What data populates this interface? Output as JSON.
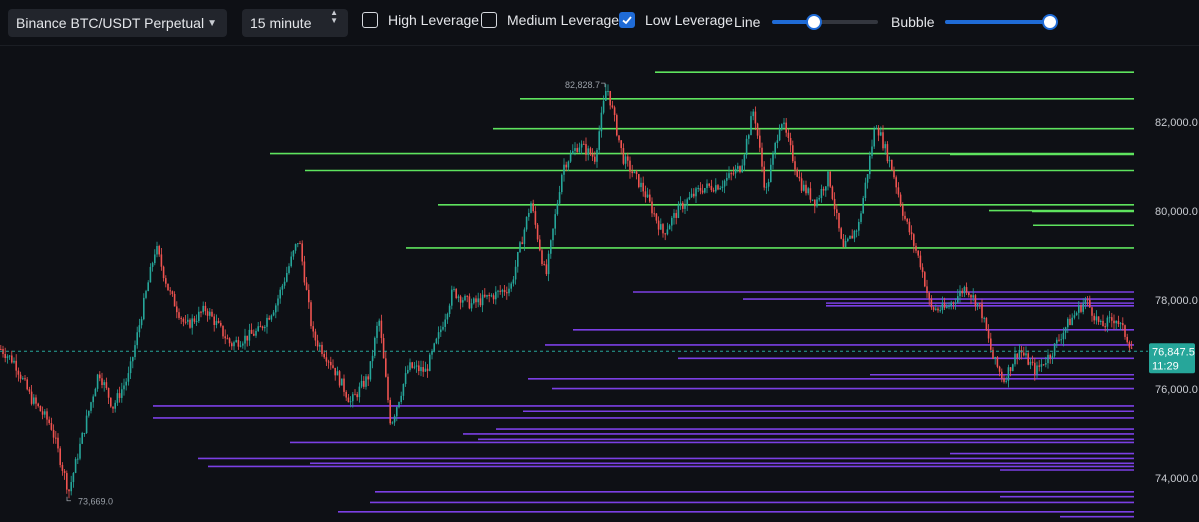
{
  "toolbar": {
    "symbol": "Binance BTC/USDT Perpetual",
    "interval": "15 minute",
    "high_leverage": {
      "label": "High Leverage",
      "checked": false
    },
    "medium_leverage": {
      "label": "Medium Leverage",
      "checked": false
    },
    "low_leverage": {
      "label": "Low Leverage",
      "checked": true
    },
    "line_label": "Line",
    "line_value": 0.38,
    "bubble_label": "Bubble",
    "bubble_value": 1.0
  },
  "colors": {
    "background": "#0e1015",
    "candle_up": "#26a69a",
    "candle_down": "#ef5350",
    "long_liquidation": "#5ee35e",
    "short_liquidation": "#7b3fe4",
    "price_tag": "#26a69a",
    "accent": "#1f6bd6"
  },
  "chart_data": {
    "type": "candlestick",
    "ylim": [
      73200,
      83200
    ],
    "yticks": [
      74000,
      76000,
      78000,
      80000,
      82000
    ],
    "ytick_labels": [
      "74,000.0",
      "76,000.0",
      "78,000.0",
      "80,000.0",
      "82,000.0"
    ],
    "current_price": 76847.5,
    "current_price_label": "76,847.5",
    "countdown": "11:29",
    "high": {
      "value": 82828.7,
      "label": "82,828.7"
    },
    "low": {
      "value": 73669.0,
      "label": "73,669.0"
    },
    "price_path": [
      [
        0,
        76900
      ],
      [
        14,
        76600
      ],
      [
        30,
        75800
      ],
      [
        50,
        75200
      ],
      [
        68,
        73700
      ],
      [
        80,
        74800
      ],
      [
        98,
        76400
      ],
      [
        112,
        75600
      ],
      [
        128,
        76300
      ],
      [
        140,
        77600
      ],
      [
        155,
        79200
      ],
      [
        168,
        78200
      ],
      [
        185,
        77400
      ],
      [
        205,
        77800
      ],
      [
        230,
        77000
      ],
      [
        258,
        77300
      ],
      [
        275,
        77900
      ],
      [
        298,
        79400
      ],
      [
        312,
        77200
      ],
      [
        330,
        76600
      ],
      [
        350,
        75700
      ],
      [
        368,
        76300
      ],
      [
        378,
        77600
      ],
      [
        390,
        75200
      ],
      [
        408,
        76500
      ],
      [
        425,
        76400
      ],
      [
        438,
        77200
      ],
      [
        452,
        78200
      ],
      [
        470,
        77900
      ],
      [
        492,
        78100
      ],
      [
        510,
        78300
      ],
      [
        530,
        80200
      ],
      [
        545,
        78500
      ],
      [
        562,
        81000
      ],
      [
        578,
        81500
      ],
      [
        594,
        81200
      ],
      [
        606,
        82830
      ],
      [
        622,
        81200
      ],
      [
        642,
        80500
      ],
      [
        662,
        79500
      ],
      [
        680,
        80100
      ],
      [
        700,
        80500
      ],
      [
        720,
        80600
      ],
      [
        740,
        81000
      ],
      [
        753,
        82300
      ],
      [
        765,
        80400
      ],
      [
        780,
        82100
      ],
      [
        800,
        80600
      ],
      [
        815,
        80200
      ],
      [
        828,
        80800
      ],
      [
        842,
        79100
      ],
      [
        858,
        79700
      ],
      [
        875,
        82000
      ],
      [
        892,
        80900
      ],
      [
        903,
        79900
      ],
      [
        920,
        78800
      ],
      [
        930,
        77800
      ],
      [
        945,
        77800
      ],
      [
        965,
        78300
      ],
      [
        980,
        77800
      ],
      [
        992,
        76700
      ],
      [
        1003,
        76200
      ],
      [
        1018,
        76900
      ],
      [
        1035,
        76400
      ],
      [
        1050,
        76800
      ],
      [
        1065,
        77400
      ],
      [
        1085,
        78000
      ],
      [
        1100,
        77400
      ],
      [
        1115,
        77600
      ],
      [
        1125,
        77200
      ],
      [
        1133,
        76850
      ]
    ],
    "long_liquidation_levels": [
      {
        "price": 83120,
        "x_start": 655
      },
      {
        "price": 82520,
        "x_start": 520
      },
      {
        "price": 81850,
        "x_start": 493
      },
      {
        "price": 81290,
        "x_start": 270
      },
      {
        "price": 81270,
        "x_start": 950
      },
      {
        "price": 80910,
        "x_start": 305
      },
      {
        "price": 80140,
        "x_start": 438
      },
      {
        "price": 80010,
        "x_start": 989
      },
      {
        "price": 79990,
        "x_start": 1032
      },
      {
        "price": 79680,
        "x_start": 1033
      },
      {
        "price": 79170,
        "x_start": 406
      }
    ],
    "short_liquidation_levels": [
      {
        "price": 78180,
        "x_start": 633
      },
      {
        "price": 78020,
        "x_start": 743
      },
      {
        "price": 77930,
        "x_start": 826
      },
      {
        "price": 77870,
        "x_start": 826
      },
      {
        "price": 77330,
        "x_start": 573
      },
      {
        "price": 76990,
        "x_start": 545
      },
      {
        "price": 76690,
        "x_start": 678
      },
      {
        "price": 76320,
        "x_start": 870
      },
      {
        "price": 76230,
        "x_start": 528
      },
      {
        "price": 76010,
        "x_start": 552
      },
      {
        "price": 75620,
        "x_start": 153
      },
      {
        "price": 75500,
        "x_start": 523
      },
      {
        "price": 75350,
        "x_start": 153
      },
      {
        "price": 75100,
        "x_start": 496
      },
      {
        "price": 74990,
        "x_start": 463
      },
      {
        "price": 74870,
        "x_start": 478
      },
      {
        "price": 74800,
        "x_start": 290
      },
      {
        "price": 74550,
        "x_start": 950
      },
      {
        "price": 74440,
        "x_start": 198
      },
      {
        "price": 74330,
        "x_start": 310
      },
      {
        "price": 74260,
        "x_start": 208
      },
      {
        "price": 74180,
        "x_start": 1000
      },
      {
        "price": 73690,
        "x_start": 375
      },
      {
        "price": 73580,
        "x_start": 1000
      },
      {
        "price": 73450,
        "x_start": 370
      },
      {
        "price": 73240,
        "x_start": 338
      },
      {
        "price": 73130,
        "x_start": 1060
      },
      {
        "price": 72980,
        "x_start": 1000
      },
      {
        "price": 72960,
        "x_start": 138
      },
      {
        "price": 72750,
        "x_start": 1048
      }
    ]
  }
}
